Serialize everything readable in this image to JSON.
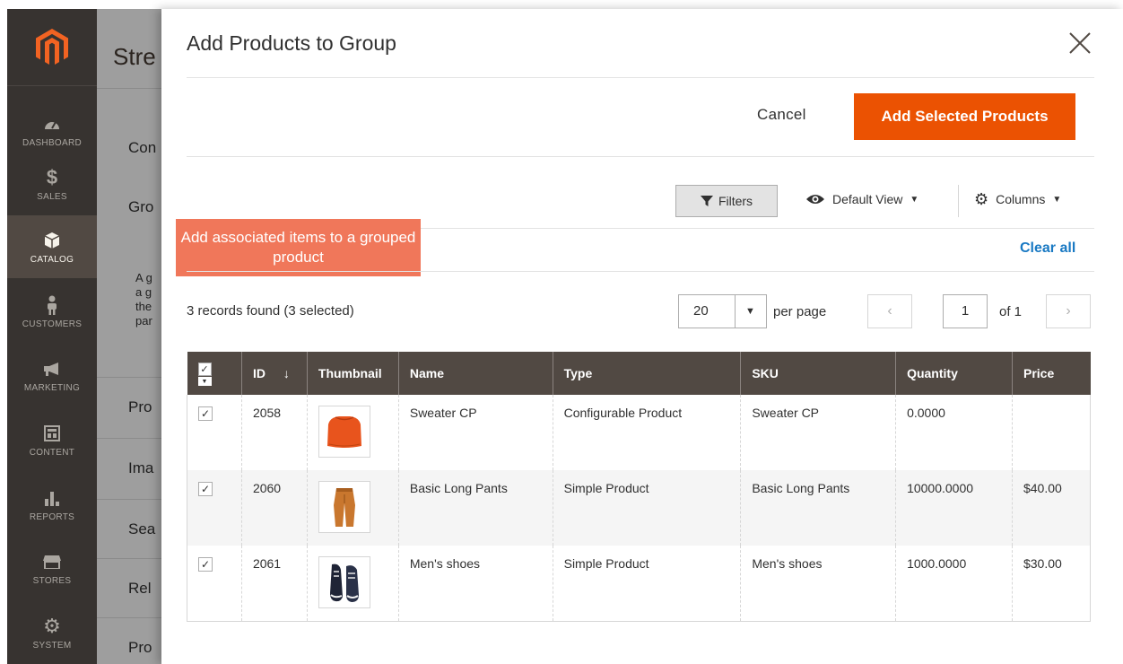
{
  "sidebar": {
    "items": [
      {
        "label": "DASHBOARD",
        "icon": "dashboard-icon"
      },
      {
        "label": "SALES",
        "icon": "dollar-icon"
      },
      {
        "label": "CATALOG",
        "icon": "box-icon"
      },
      {
        "label": "CUSTOMERS",
        "icon": "person-icon"
      },
      {
        "label": "MARKETING",
        "icon": "megaphone-icon"
      },
      {
        "label": "CONTENT",
        "icon": "layout-icon"
      },
      {
        "label": "REPORTS",
        "icon": "bar-chart-icon"
      },
      {
        "label": "STORES",
        "icon": "store-icon"
      },
      {
        "label": "SYSTEM",
        "icon": "gear-icon"
      }
    ],
    "active": "CATALOG"
  },
  "background_page": {
    "title": "Stre",
    "sections": [
      "Con",
      "Gro",
      "Pro",
      "Ima",
      "Sea",
      "Rel",
      "Pro"
    ],
    "paragraph": [
      "A g",
      "a g",
      "the",
      "par"
    ]
  },
  "modal": {
    "title": "Add Products to Group",
    "cancel_label": "Cancel",
    "add_label": "Add Selected Products",
    "filters_label": "Filters",
    "view_label": "Default View",
    "columns_label": "Columns",
    "callout": "Add associated items to a grouped product",
    "clear_all": "Clear all",
    "records_text": "3 records found (3 selected)",
    "per_page_value": "20",
    "per_page_label": "per page",
    "page_value": "1",
    "page_of": "of 1"
  },
  "grid": {
    "columns": [
      "ID",
      "Thumbnail",
      "Name",
      "Type",
      "SKU",
      "Quantity",
      "Price"
    ],
    "rows": [
      {
        "id": "2058",
        "name": "Sweater CP",
        "type": "Configurable Product",
        "sku": "Sweater CP",
        "quantity": "0.0000",
        "price": "",
        "thumb": "sweater"
      },
      {
        "id": "2060",
        "name": "Basic Long Pants",
        "type": "Simple Product",
        "sku": "Basic Long Pants",
        "quantity": "10000.0000",
        "price": "$40.00",
        "thumb": "pants"
      },
      {
        "id": "2061",
        "name": "Men's shoes",
        "type": "Simple Product",
        "sku": "Men's shoes",
        "quantity": "1000.0000",
        "price": "$30.00",
        "thumb": "shoes"
      }
    ]
  },
  "colors": {
    "accent": "#eb5202",
    "callout": "#f0775a",
    "sidebar": "#373330",
    "header": "#514943",
    "link": "#1979c3"
  }
}
